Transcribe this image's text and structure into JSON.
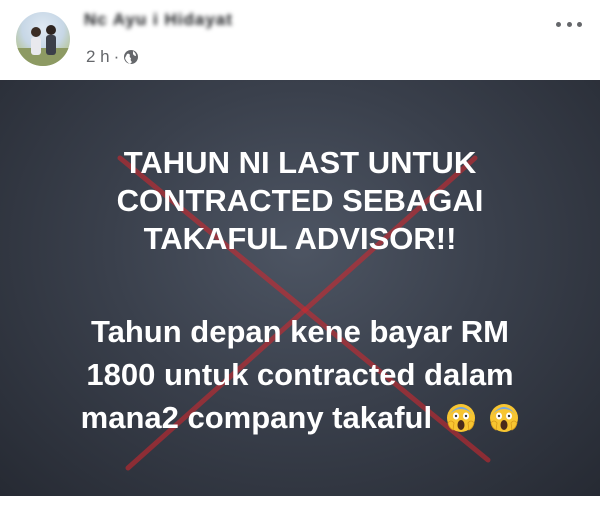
{
  "header": {
    "author_name": "Nc   Ayu  i Hidayat",
    "timestamp": "2 h",
    "separator": "·",
    "visibility_icon": "globe-icon",
    "more_icon": "more-options-icon"
  },
  "post": {
    "headline_lines": [
      "TAHUN NI LAST UNTUK",
      "CONTRACTED SEBAGAI",
      "TAKAFUL ADVISOR!!"
    ],
    "body_lines": [
      "Tahun depan kene bayar RM",
      "1800 untuk contracted dalam",
      "mana2 company takaful"
    ],
    "emoji": [
      "face-screaming-in-fear-emoji",
      "face-screaming-in-fear-emoji"
    ],
    "overlay_icon": "red-x-cross-icon",
    "colors": {
      "background": "#2f343e",
      "text": "#ffffff",
      "cross": "#d8262c"
    }
  }
}
